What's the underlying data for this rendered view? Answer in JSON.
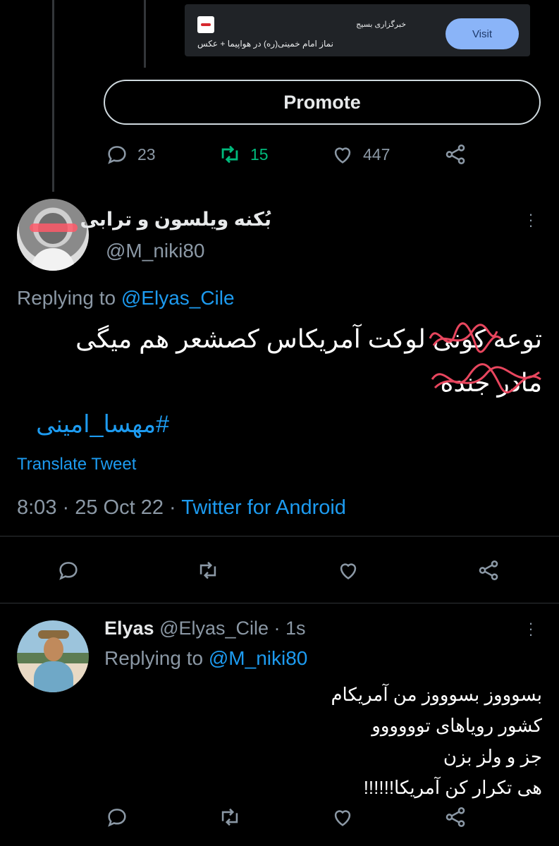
{
  "promoted": {
    "source": "خبرگزاری بسیج",
    "caption": "نماز امام خمینی(ره) در هواپیما + عکس",
    "visit_label": "Visit",
    "promote_label": "Promote"
  },
  "top_actions": {
    "replies": "23",
    "retweets": "15",
    "likes": "447"
  },
  "tweet": {
    "display_name": "بُکنه ویلسون و ترابی",
    "handle": "@M_niki80",
    "replying_prefix": "Replying to",
    "replying_handle": "@Elyas_Cile",
    "body_line1": "توعه کونی لوکت آمریکاس کصشعر هم میگی",
    "body_line2": "مادر جنده",
    "hashtag": "#مهسا_امینی",
    "translate": "Translate Tweet",
    "timestamp": "8:03 · 25 Oct 22 · ",
    "client": "Twitter for Android"
  },
  "reply": {
    "name": "Elyas",
    "handle_time": " @Elyas_Cile · 1s",
    "replying_prefix": "Replying to",
    "replying_handle": "@M_niki80",
    "lines": [
      "بسوووز بسوووز من آمریکام",
      "کشور رویاهای توووووو",
      "جز و ولز بزن",
      "هی تکرار کن آمریکا!!!!!!"
    ]
  },
  "colors": {
    "background": "#000000",
    "link": "#1d9bf0",
    "retweet_green": "#00ba7c",
    "muted": "#8b98a5"
  }
}
